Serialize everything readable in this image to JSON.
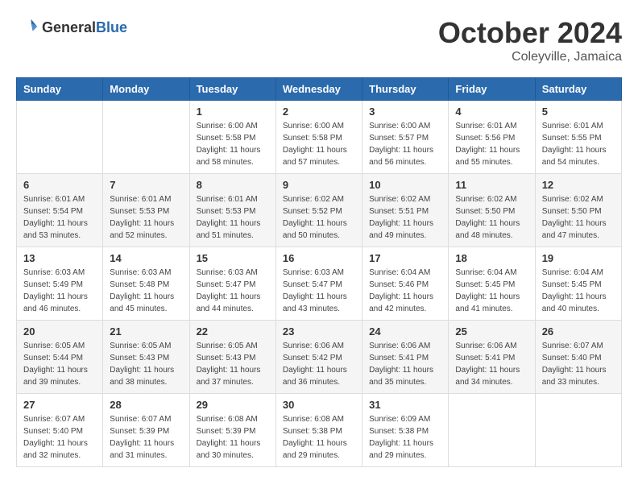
{
  "header": {
    "logo": {
      "general": "General",
      "blue": "Blue"
    },
    "title": "October 2024",
    "location": "Coleyville, Jamaica"
  },
  "calendar": {
    "days_of_week": [
      "Sunday",
      "Monday",
      "Tuesday",
      "Wednesday",
      "Thursday",
      "Friday",
      "Saturday"
    ],
    "weeks": [
      [
        {
          "day": null,
          "info": null
        },
        {
          "day": null,
          "info": null
        },
        {
          "day": "1",
          "info": "Sunrise: 6:00 AM\nSunset: 5:58 PM\nDaylight: 11 hours and 58 minutes."
        },
        {
          "day": "2",
          "info": "Sunrise: 6:00 AM\nSunset: 5:58 PM\nDaylight: 11 hours and 57 minutes."
        },
        {
          "day": "3",
          "info": "Sunrise: 6:00 AM\nSunset: 5:57 PM\nDaylight: 11 hours and 56 minutes."
        },
        {
          "day": "4",
          "info": "Sunrise: 6:01 AM\nSunset: 5:56 PM\nDaylight: 11 hours and 55 minutes."
        },
        {
          "day": "5",
          "info": "Sunrise: 6:01 AM\nSunset: 5:55 PM\nDaylight: 11 hours and 54 minutes."
        }
      ],
      [
        {
          "day": "6",
          "info": "Sunrise: 6:01 AM\nSunset: 5:54 PM\nDaylight: 11 hours and 53 minutes."
        },
        {
          "day": "7",
          "info": "Sunrise: 6:01 AM\nSunset: 5:53 PM\nDaylight: 11 hours and 52 minutes."
        },
        {
          "day": "8",
          "info": "Sunrise: 6:01 AM\nSunset: 5:53 PM\nDaylight: 11 hours and 51 minutes."
        },
        {
          "day": "9",
          "info": "Sunrise: 6:02 AM\nSunset: 5:52 PM\nDaylight: 11 hours and 50 minutes."
        },
        {
          "day": "10",
          "info": "Sunrise: 6:02 AM\nSunset: 5:51 PM\nDaylight: 11 hours and 49 minutes."
        },
        {
          "day": "11",
          "info": "Sunrise: 6:02 AM\nSunset: 5:50 PM\nDaylight: 11 hours and 48 minutes."
        },
        {
          "day": "12",
          "info": "Sunrise: 6:02 AM\nSunset: 5:50 PM\nDaylight: 11 hours and 47 minutes."
        }
      ],
      [
        {
          "day": "13",
          "info": "Sunrise: 6:03 AM\nSunset: 5:49 PM\nDaylight: 11 hours and 46 minutes."
        },
        {
          "day": "14",
          "info": "Sunrise: 6:03 AM\nSunset: 5:48 PM\nDaylight: 11 hours and 45 minutes."
        },
        {
          "day": "15",
          "info": "Sunrise: 6:03 AM\nSunset: 5:47 PM\nDaylight: 11 hours and 44 minutes."
        },
        {
          "day": "16",
          "info": "Sunrise: 6:03 AM\nSunset: 5:47 PM\nDaylight: 11 hours and 43 minutes."
        },
        {
          "day": "17",
          "info": "Sunrise: 6:04 AM\nSunset: 5:46 PM\nDaylight: 11 hours and 42 minutes."
        },
        {
          "day": "18",
          "info": "Sunrise: 6:04 AM\nSunset: 5:45 PM\nDaylight: 11 hours and 41 minutes."
        },
        {
          "day": "19",
          "info": "Sunrise: 6:04 AM\nSunset: 5:45 PM\nDaylight: 11 hours and 40 minutes."
        }
      ],
      [
        {
          "day": "20",
          "info": "Sunrise: 6:05 AM\nSunset: 5:44 PM\nDaylight: 11 hours and 39 minutes."
        },
        {
          "day": "21",
          "info": "Sunrise: 6:05 AM\nSunset: 5:43 PM\nDaylight: 11 hours and 38 minutes."
        },
        {
          "day": "22",
          "info": "Sunrise: 6:05 AM\nSunset: 5:43 PM\nDaylight: 11 hours and 37 minutes."
        },
        {
          "day": "23",
          "info": "Sunrise: 6:06 AM\nSunset: 5:42 PM\nDaylight: 11 hours and 36 minutes."
        },
        {
          "day": "24",
          "info": "Sunrise: 6:06 AM\nSunset: 5:41 PM\nDaylight: 11 hours and 35 minutes."
        },
        {
          "day": "25",
          "info": "Sunrise: 6:06 AM\nSunset: 5:41 PM\nDaylight: 11 hours and 34 minutes."
        },
        {
          "day": "26",
          "info": "Sunrise: 6:07 AM\nSunset: 5:40 PM\nDaylight: 11 hours and 33 minutes."
        }
      ],
      [
        {
          "day": "27",
          "info": "Sunrise: 6:07 AM\nSunset: 5:40 PM\nDaylight: 11 hours and 32 minutes."
        },
        {
          "day": "28",
          "info": "Sunrise: 6:07 AM\nSunset: 5:39 PM\nDaylight: 11 hours and 31 minutes."
        },
        {
          "day": "29",
          "info": "Sunrise: 6:08 AM\nSunset: 5:39 PM\nDaylight: 11 hours and 30 minutes."
        },
        {
          "day": "30",
          "info": "Sunrise: 6:08 AM\nSunset: 5:38 PM\nDaylight: 11 hours and 29 minutes."
        },
        {
          "day": "31",
          "info": "Sunrise: 6:09 AM\nSunset: 5:38 PM\nDaylight: 11 hours and 29 minutes."
        },
        {
          "day": null,
          "info": null
        },
        {
          "day": null,
          "info": null
        }
      ]
    ]
  }
}
